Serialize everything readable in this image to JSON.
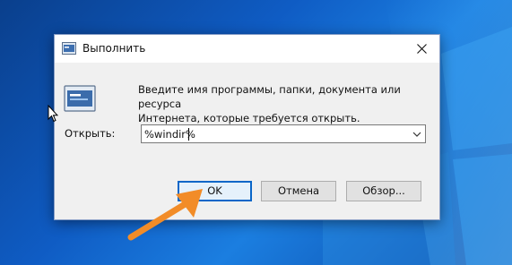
{
  "dialog": {
    "title": "Выполнить",
    "description_line1": "Введите имя программы, папки, документа или ресурса",
    "description_line2": "Интернета, которые требуется открыть.",
    "open_label": "Открыть:",
    "open_value": "%windir%",
    "buttons": {
      "ok": "OK",
      "cancel": "Отмена",
      "browse": "Обзор..."
    }
  },
  "icons": {
    "title": "run-icon",
    "main": "run-icon",
    "close": "close-icon",
    "dropdown": "chevron-down-icon",
    "cursor": "mouse-cursor-icon",
    "annotation": "orange-arrow-icon"
  },
  "colors": {
    "desktop": "#0f5cc4",
    "dialog_bg": "#f0f0f0",
    "ok_border": "#0a66c8",
    "arrow": "#f28c28"
  }
}
